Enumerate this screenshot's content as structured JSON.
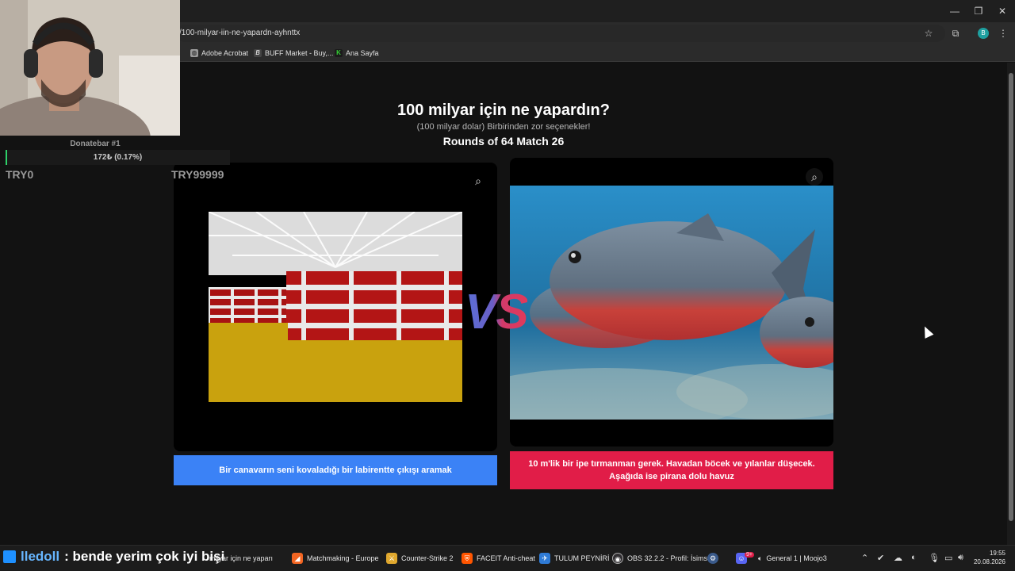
{
  "browser": {
    "url": "/100-milyar-iin-ne-yapardn-ayhnttx",
    "bookmarks": [
      {
        "label": "Adobe Acrobat",
        "color": "#9a9a9a"
      },
      {
        "label": "BUFF Market - Buy,...",
        "color": "#444444"
      },
      {
        "label": "Ana Sayfa",
        "color": "#35d135"
      }
    ],
    "profile_initial": "B"
  },
  "page": {
    "title": "100 milyar için ne yapardın?",
    "subtitle": "(100 milyar dolar) Birbirinden zor seçenekler!",
    "round_info": "Rounds of 64 Match 26",
    "vs": "VS",
    "left_choice": {
      "label": "Bir canavarın seni kovaladığı bir labirentte çıkışı aramak",
      "color": "#3b82f6"
    },
    "right_choice": {
      "label": "10 m'lik bir ipe tırmanman gerek. Havadan böcek ve yılanlar düşecek. Aşağıda ise pirana dolu havuz",
      "color": "#e11d48"
    }
  },
  "overlay": {
    "donate_label": "Donatebar #1",
    "donate_value": "172₺ (0.17%)",
    "donate_progress": 0.17,
    "try_min": "TRY0",
    "try_max": "TRY99999"
  },
  "taskbar": {
    "chat_user": "lledoll",
    "chat_message": ": bende yerim çok iyi bişi",
    "items": [
      {
        "label": "milyar için ne yaparı",
        "color": "#4a7bd6"
      },
      {
        "label": "Matchmaking - Europe",
        "color": "#f26522"
      },
      {
        "label": "Counter-Strike 2",
        "color": "#e0a82e"
      },
      {
        "label": "FACEIT Anti-cheat",
        "color": "#ff5500"
      },
      {
        "label": "TULUM PEYNİRİ",
        "color": "#2f7bd6"
      },
      {
        "label": "OBS 32.2.2 - Profil: İsims",
        "color": "#302e31"
      },
      {
        "label": "General 1 | Moojo3",
        "color": "#5865f2"
      }
    ],
    "discord_badge": "9+",
    "time": "19:55",
    "date": "20.08.2026"
  }
}
